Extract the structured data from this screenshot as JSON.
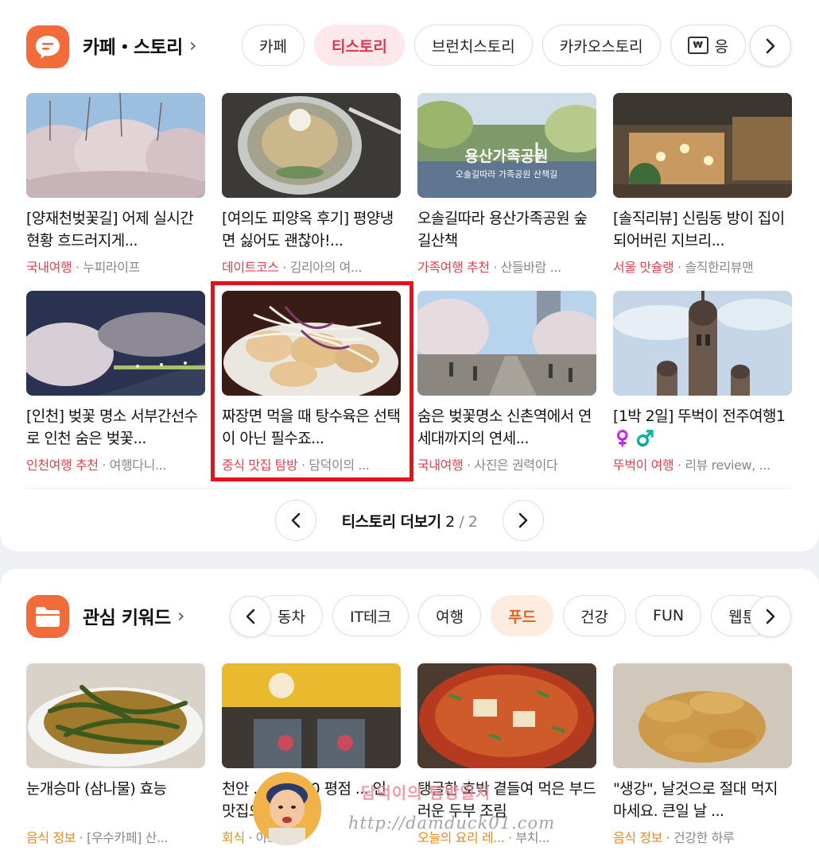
{
  "section1": {
    "title": "카페・스토리",
    "chevron": "›",
    "tabs": [
      {
        "label": "카페",
        "active": false
      },
      {
        "label": "티스토리",
        "active": true
      },
      {
        "label": "브런치스토리",
        "active": false
      },
      {
        "label": "카카오스토리",
        "active": false
      },
      {
        "label": "응",
        "active": false
      }
    ],
    "items": [
      {
        "title": "[양재천벚꽃길] 어제 실시간 현황 흐드러지게...",
        "category": "국내여행",
        "source": "누피라이프"
      },
      {
        "title": "[여의도 피양옥 후기] 평양냉면 싫어도 괜찮아!...",
        "category": "데이트코스",
        "source": "김리아의 여..."
      },
      {
        "title": "오솔길따라 용산가족공원 숲길산책",
        "category": "가족여행 추천",
        "source": "산들바람 ...",
        "thumb_caption": "용산가족공원",
        "thumb_subcaption": "오솔길따라 가족공원 산책길"
      },
      {
        "title": "[솔직리뷰] 신림동 방이 집이 되어버린 지브리...",
        "category": "서울 맛슐랭",
        "source": "솔직한리뷰맨"
      },
      {
        "title": "[인천] 벚꽃 명소 서부간선수로 인천 숨은 벚꽃...",
        "category": "인천여행 추천",
        "source": "여행다니..."
      },
      {
        "title": "짜장면 먹을 때 탕수육은 선택이 아닌 필수죠...",
        "category": "중식 맛집 탐방",
        "source": "담덕이의 ..."
      },
      {
        "title": "숨은 벚꽃명소 신촌역에서 연세대까지의 연세...",
        "category": "국내여행",
        "source": "사진은 권력이다"
      },
      {
        "title": "[1박 2일] 뚜벅이 전주여행1 ♀️ ♂️",
        "category": "뚜벅이 여행",
        "source": "리뷰 review, ..."
      }
    ],
    "pager": {
      "label": "티스토리 더보기",
      "current": "2",
      "separator": "/",
      "total": "2"
    }
  },
  "section2": {
    "title": "관심 키워드",
    "chevron": "›",
    "tabs": [
      {
        "label": "동차",
        "active": false
      },
      {
        "label": "IT테크",
        "active": false
      },
      {
        "label": "여행",
        "active": false
      },
      {
        "label": "푸드",
        "active": true
      },
      {
        "label": "건강",
        "active": false
      },
      {
        "label": "FUN",
        "active": false
      },
      {
        "label": "웹툰",
        "active": false
      }
    ],
    "items": [
      {
        "title": "눈개승마 (삼나물) 효능",
        "category": "음식 정보",
        "source": "[우수카페] 산..."
      },
      {
        "title": "천안 ... 스트 10 평점 ... 인 맛집으...",
        "category": "회식",
        "source": "아보자"
      },
      {
        "title": "탱글한 호박 곁들여 먹은 부드러운 두부 조림",
        "category": "오늘의 요리 레...",
        "source": "부치..."
      },
      {
        "title": "\"생강\", 날것으로 절대 먹지 마세요. 큰일 날 ...",
        "category": "음식 정보",
        "source": "건강한 하루"
      }
    ]
  },
  "watermark": {
    "name": "담덕이의 탐방일지",
    "url": "http://damduck01.com"
  },
  "colors": {
    "accent_pink": "#e0344c",
    "accent_orange": "#e2621d",
    "icon_orange": "#f26b3a",
    "highlight_red": "#e8111a"
  }
}
